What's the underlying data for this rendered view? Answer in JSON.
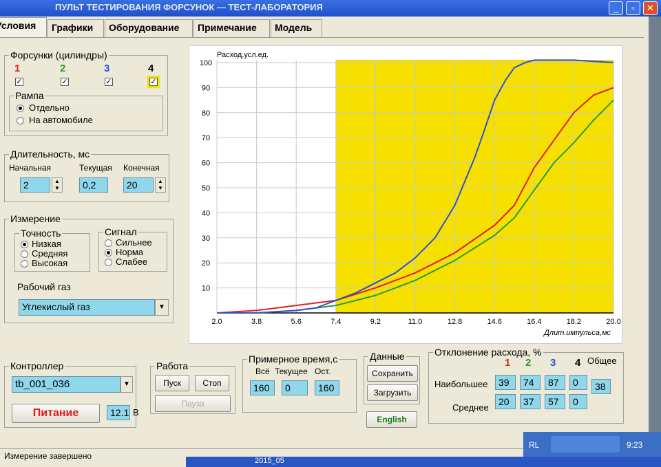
{
  "title": "ПУЛЬТ ТЕСТИРОВАНИЯ ФОРСУНОК — ТЕСТ-ЛАБОРАТОРИЯ",
  "window_controls": {
    "minimize": "_",
    "restore": "▫",
    "close": "✕"
  },
  "tabs": [
    "Условия",
    "Графики",
    "Оборудование",
    "Примечание",
    "Модель"
  ],
  "injectors": {
    "title": "Форсунки (цилиндры)",
    "labels": [
      "1",
      "2",
      "3",
      "4"
    ],
    "colors": [
      "#e02020",
      "#2a9a2a",
      "#2a4fd8",
      "#000000"
    ],
    "checked": [
      true,
      true,
      true,
      true
    ]
  },
  "rampa": {
    "title": "Рампа",
    "options": [
      "Отдельно",
      "На автомобиле"
    ],
    "selected": 0
  },
  "duration": {
    "title": "Длительность, мс",
    "start_label": "Начальная",
    "current_label": "Текущая",
    "end_label": "Конечная",
    "start": "2",
    "current": "0,2",
    "end": "20"
  },
  "measure": {
    "title": "Измерение",
    "precision_title": "Точность",
    "precision_options": [
      "Низкая",
      "Средняя",
      "Высокая"
    ],
    "precision_selected": 0,
    "signal_title": "Сигнал",
    "signal_options": [
      "Сильнее",
      "Норма",
      "Слабее"
    ],
    "signal_selected": 1,
    "gas_label": "Рабочий газ",
    "gas_value": "Углекислый газ"
  },
  "controller": {
    "title": "Контроллер",
    "value": "tb_001_036",
    "power_label": "Питание",
    "voltage": "12.1",
    "voltage_unit": "В"
  },
  "work": {
    "title": "Работа",
    "start": "Пуск",
    "stop": "Стоп",
    "pause": "Пауза"
  },
  "time": {
    "title": "Примерное время,с",
    "all_label": "Всё",
    "current_label": "Текущее",
    "left_label": "Ост.",
    "all": "160",
    "current": "0",
    "left": "160"
  },
  "data_box": {
    "title": "Данные",
    "save": "Сохранить",
    "load": "Загрузить",
    "english": "English"
  },
  "deviation": {
    "title": "Отклонение расхода, %",
    "cols": [
      "1",
      "2",
      "3",
      "4",
      "Общее"
    ],
    "max_label": "Наибольшее",
    "avg_label": "Среднее",
    "max": [
      "39",
      "74",
      "87",
      "0"
    ],
    "avg": [
      "20",
      "37",
      "57",
      "0"
    ],
    "total": "38"
  },
  "status": "Измерение завершено",
  "tray": {
    "lang": "RL",
    "clock": "9:23"
  },
  "taskbar_text": "2015_05",
  "chart_data": {
    "type": "line",
    "ylabel": "Расход,усл.ед.",
    "xlabel": "Длит.импульса,мс",
    "xlim": [
      2.0,
      20.0
    ],
    "ylim": [
      0,
      100
    ],
    "xticks": [
      "2.0",
      "3.8",
      "5.6",
      "7.4",
      "9.2",
      "11.0",
      "12.8",
      "14.6",
      "16.4",
      "18.2",
      "20.0"
    ],
    "yticks": [
      "10",
      "20",
      "30",
      "40",
      "50",
      "60",
      "70",
      "80",
      "90",
      "100"
    ],
    "highlight_from": 7.4,
    "highlight_color": "#f5e000",
    "grid": true,
    "series": [
      {
        "color": "#e02020",
        "x": [
          2.0,
          3.8,
          5.6,
          7.4,
          9.2,
          11.0,
          12.8,
          14.6,
          15.5,
          16.4,
          17.3,
          18.2,
          19.1,
          20.0
        ],
        "y": [
          0,
          1,
          3,
          5,
          10,
          16,
          24,
          35,
          43,
          58,
          69,
          80,
          87,
          90
        ]
      },
      {
        "color": "#2a9a2a",
        "x": [
          2.0,
          3.8,
          5.6,
          7.4,
          9.2,
          11.0,
          12.8,
          14.6,
          15.5,
          16.4,
          17.3,
          18.2,
          19.1,
          20.0
        ],
        "y": [
          0,
          0,
          1,
          3,
          7,
          13,
          21,
          31,
          38,
          49,
          60,
          68,
          77,
          85
        ]
      },
      {
        "color": "#2a4fd8",
        "x": [
          2.0,
          3.8,
          5.6,
          6.5,
          7.4,
          8.3,
          9.2,
          10.1,
          11.0,
          11.9,
          12.8,
          13.7,
          14.1,
          14.6,
          15.1,
          15.5,
          16.0,
          16.4,
          18.2,
          20.0
        ],
        "y": [
          0,
          0,
          1,
          2,
          5,
          8,
          12,
          16,
          22,
          30,
          43,
          62,
          72,
          85,
          93,
          98,
          100,
          101,
          101,
          100
        ]
      }
    ]
  }
}
